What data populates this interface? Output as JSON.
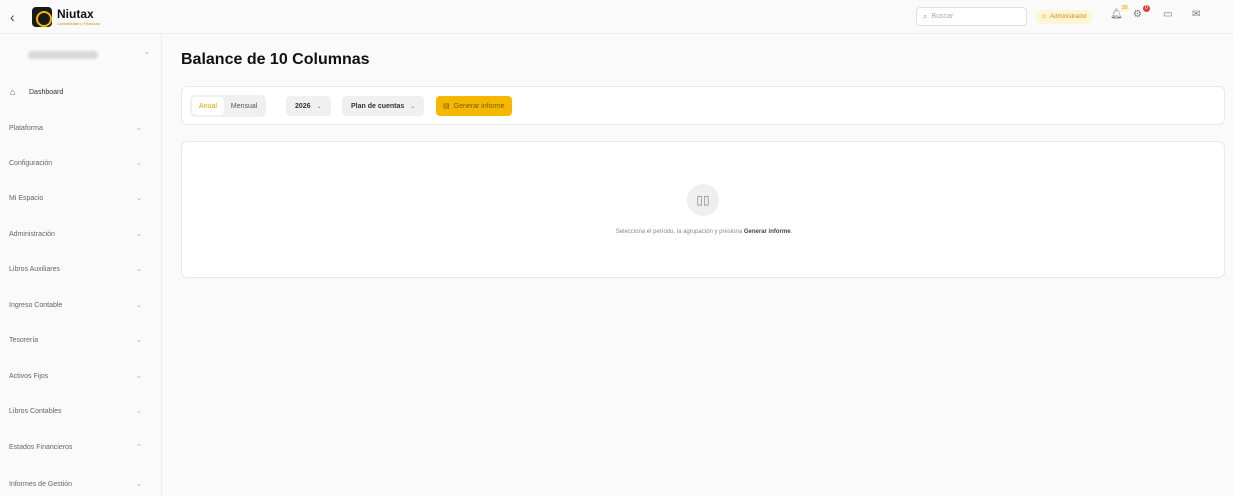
{
  "header": {
    "brand_name": "Niutax",
    "brand_tagline": "Contabilidad y Finanzas",
    "search_placeholder": "Buscar",
    "role_label": "Administrador",
    "notifications_count": "30",
    "alerts_count": "0"
  },
  "sidebar": {
    "items": [
      {
        "label": "Dashboard"
      },
      {
        "label": "Plataforma"
      },
      {
        "label": "Configuración"
      },
      {
        "label": "Mi Espacio"
      },
      {
        "label": "Administración"
      },
      {
        "label": "Libros Auxiliares"
      },
      {
        "label": "Ingreso Contable"
      },
      {
        "label": "Tesorería"
      },
      {
        "label": "Activos Fijos"
      },
      {
        "label": "Libros Contables"
      },
      {
        "label": "Estados Financieros"
      },
      {
        "label": "Informes de Gestión"
      }
    ]
  },
  "main": {
    "title": "Balance de 10 Columnas",
    "period_options": [
      "Anual",
      "Mensual"
    ],
    "selected_period": "Anual",
    "year_value": "2026",
    "plan_label": "Plan de cuentas",
    "generate_label": "Generar informe",
    "empty_text_prefix": "Selecciona el período, la agrupación y presiona",
    "empty_text_bold": "Generar informe",
    "empty_text_suffix": "."
  },
  "colors": {
    "accent": "#f5b800",
    "background": "#fafafa"
  }
}
